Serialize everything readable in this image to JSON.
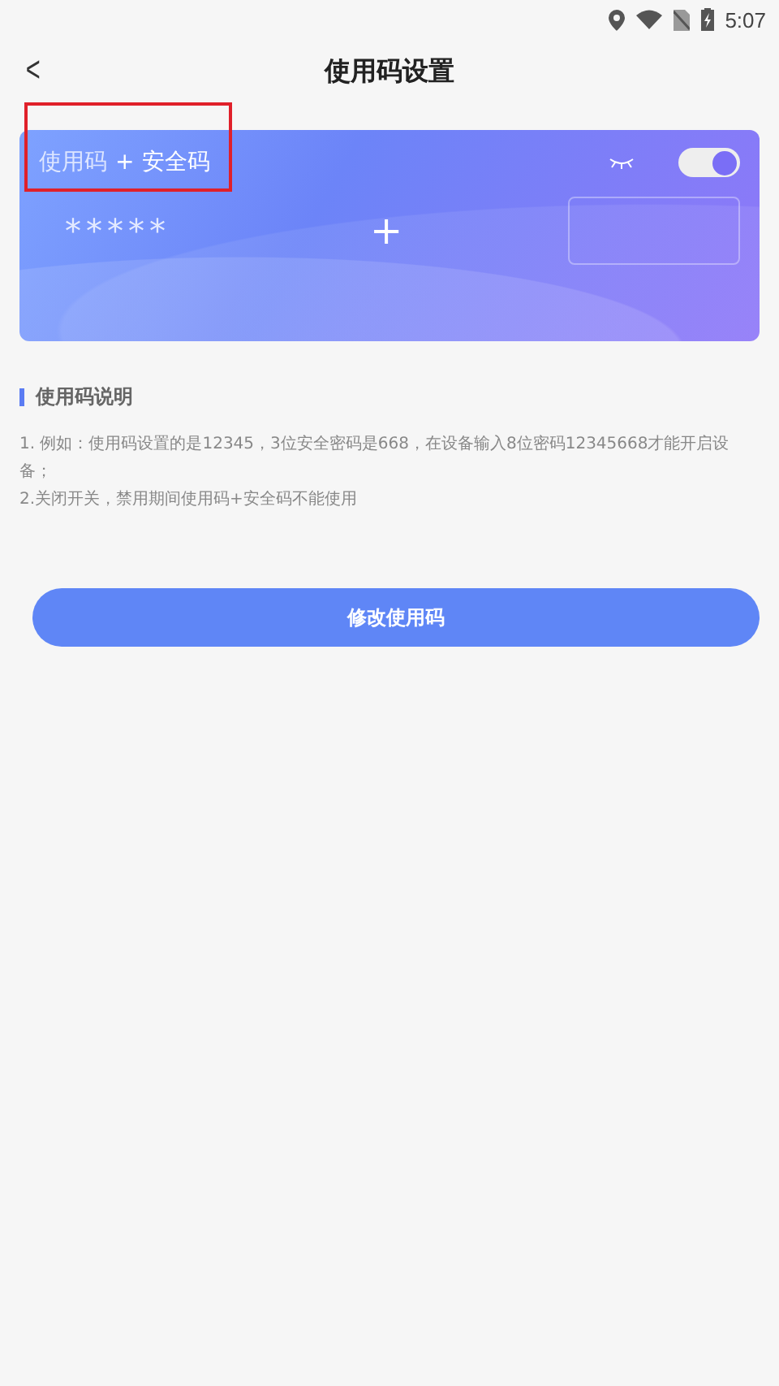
{
  "status_bar": {
    "time": "5:07"
  },
  "header": {
    "back": "<",
    "title": "使用码设置"
  },
  "card": {
    "code_label": "使用码",
    "plus_label": "+",
    "security_label": "安全码",
    "toggle": {
      "on": true
    },
    "code_value": "*****",
    "plus": "+"
  },
  "section": {
    "title": "使用码说明",
    "lines": [
      "1. 例如：使用码设置的是12345，3位安全密码是668，在设备输入8位密码12345668才能开启设备；",
      "2.关闭开关，禁用期间使用码+安全码不能使用"
    ]
  },
  "button": {
    "label": "修改使用码"
  }
}
